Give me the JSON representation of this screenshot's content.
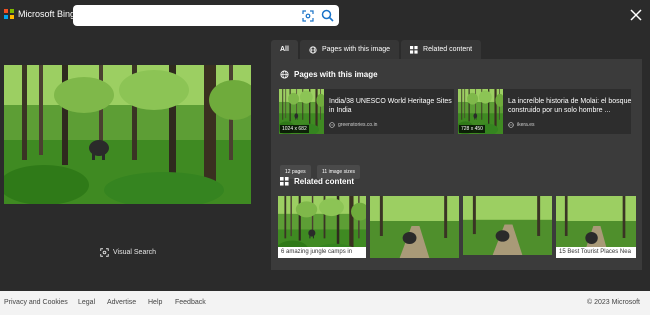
{
  "header": {
    "logo_text": "Microsoft Bing",
    "search_value": "",
    "logo_colors": [
      "#f25022",
      "#7fba00",
      "#00a4ef",
      "#ffb900"
    ]
  },
  "left": {
    "visual_search_label": "Visual Search"
  },
  "tabs": [
    {
      "label": "All"
    },
    {
      "label": "Pages with this image"
    },
    {
      "label": "Related content"
    }
  ],
  "pages_section": {
    "title": "Pages with this image",
    "cards": [
      {
        "title": "India/38 UNESCO World Heritage Sites in India",
        "source": "greenstories.co.in",
        "size": "1024 x 682"
      },
      {
        "title": "La increíble historia de Molai: el bosque construido por un solo hombre ...",
        "source": "ikera.es",
        "size": "728 x 450"
      }
    ],
    "chips": [
      "12 pages",
      "11 image sizes"
    ]
  },
  "related_section": {
    "title": "Related content",
    "items": [
      {
        "caption": "6 amazing jungle camps in"
      },
      {
        "caption": ""
      },
      {
        "caption": ""
      },
      {
        "caption": "15 Best Tourist Places Nea"
      }
    ]
  },
  "footer": {
    "links": [
      "Privacy and Cookies",
      "Legal",
      "Advertise",
      "Help",
      "Feedback"
    ],
    "copyright": "© 2023 Microsoft"
  }
}
